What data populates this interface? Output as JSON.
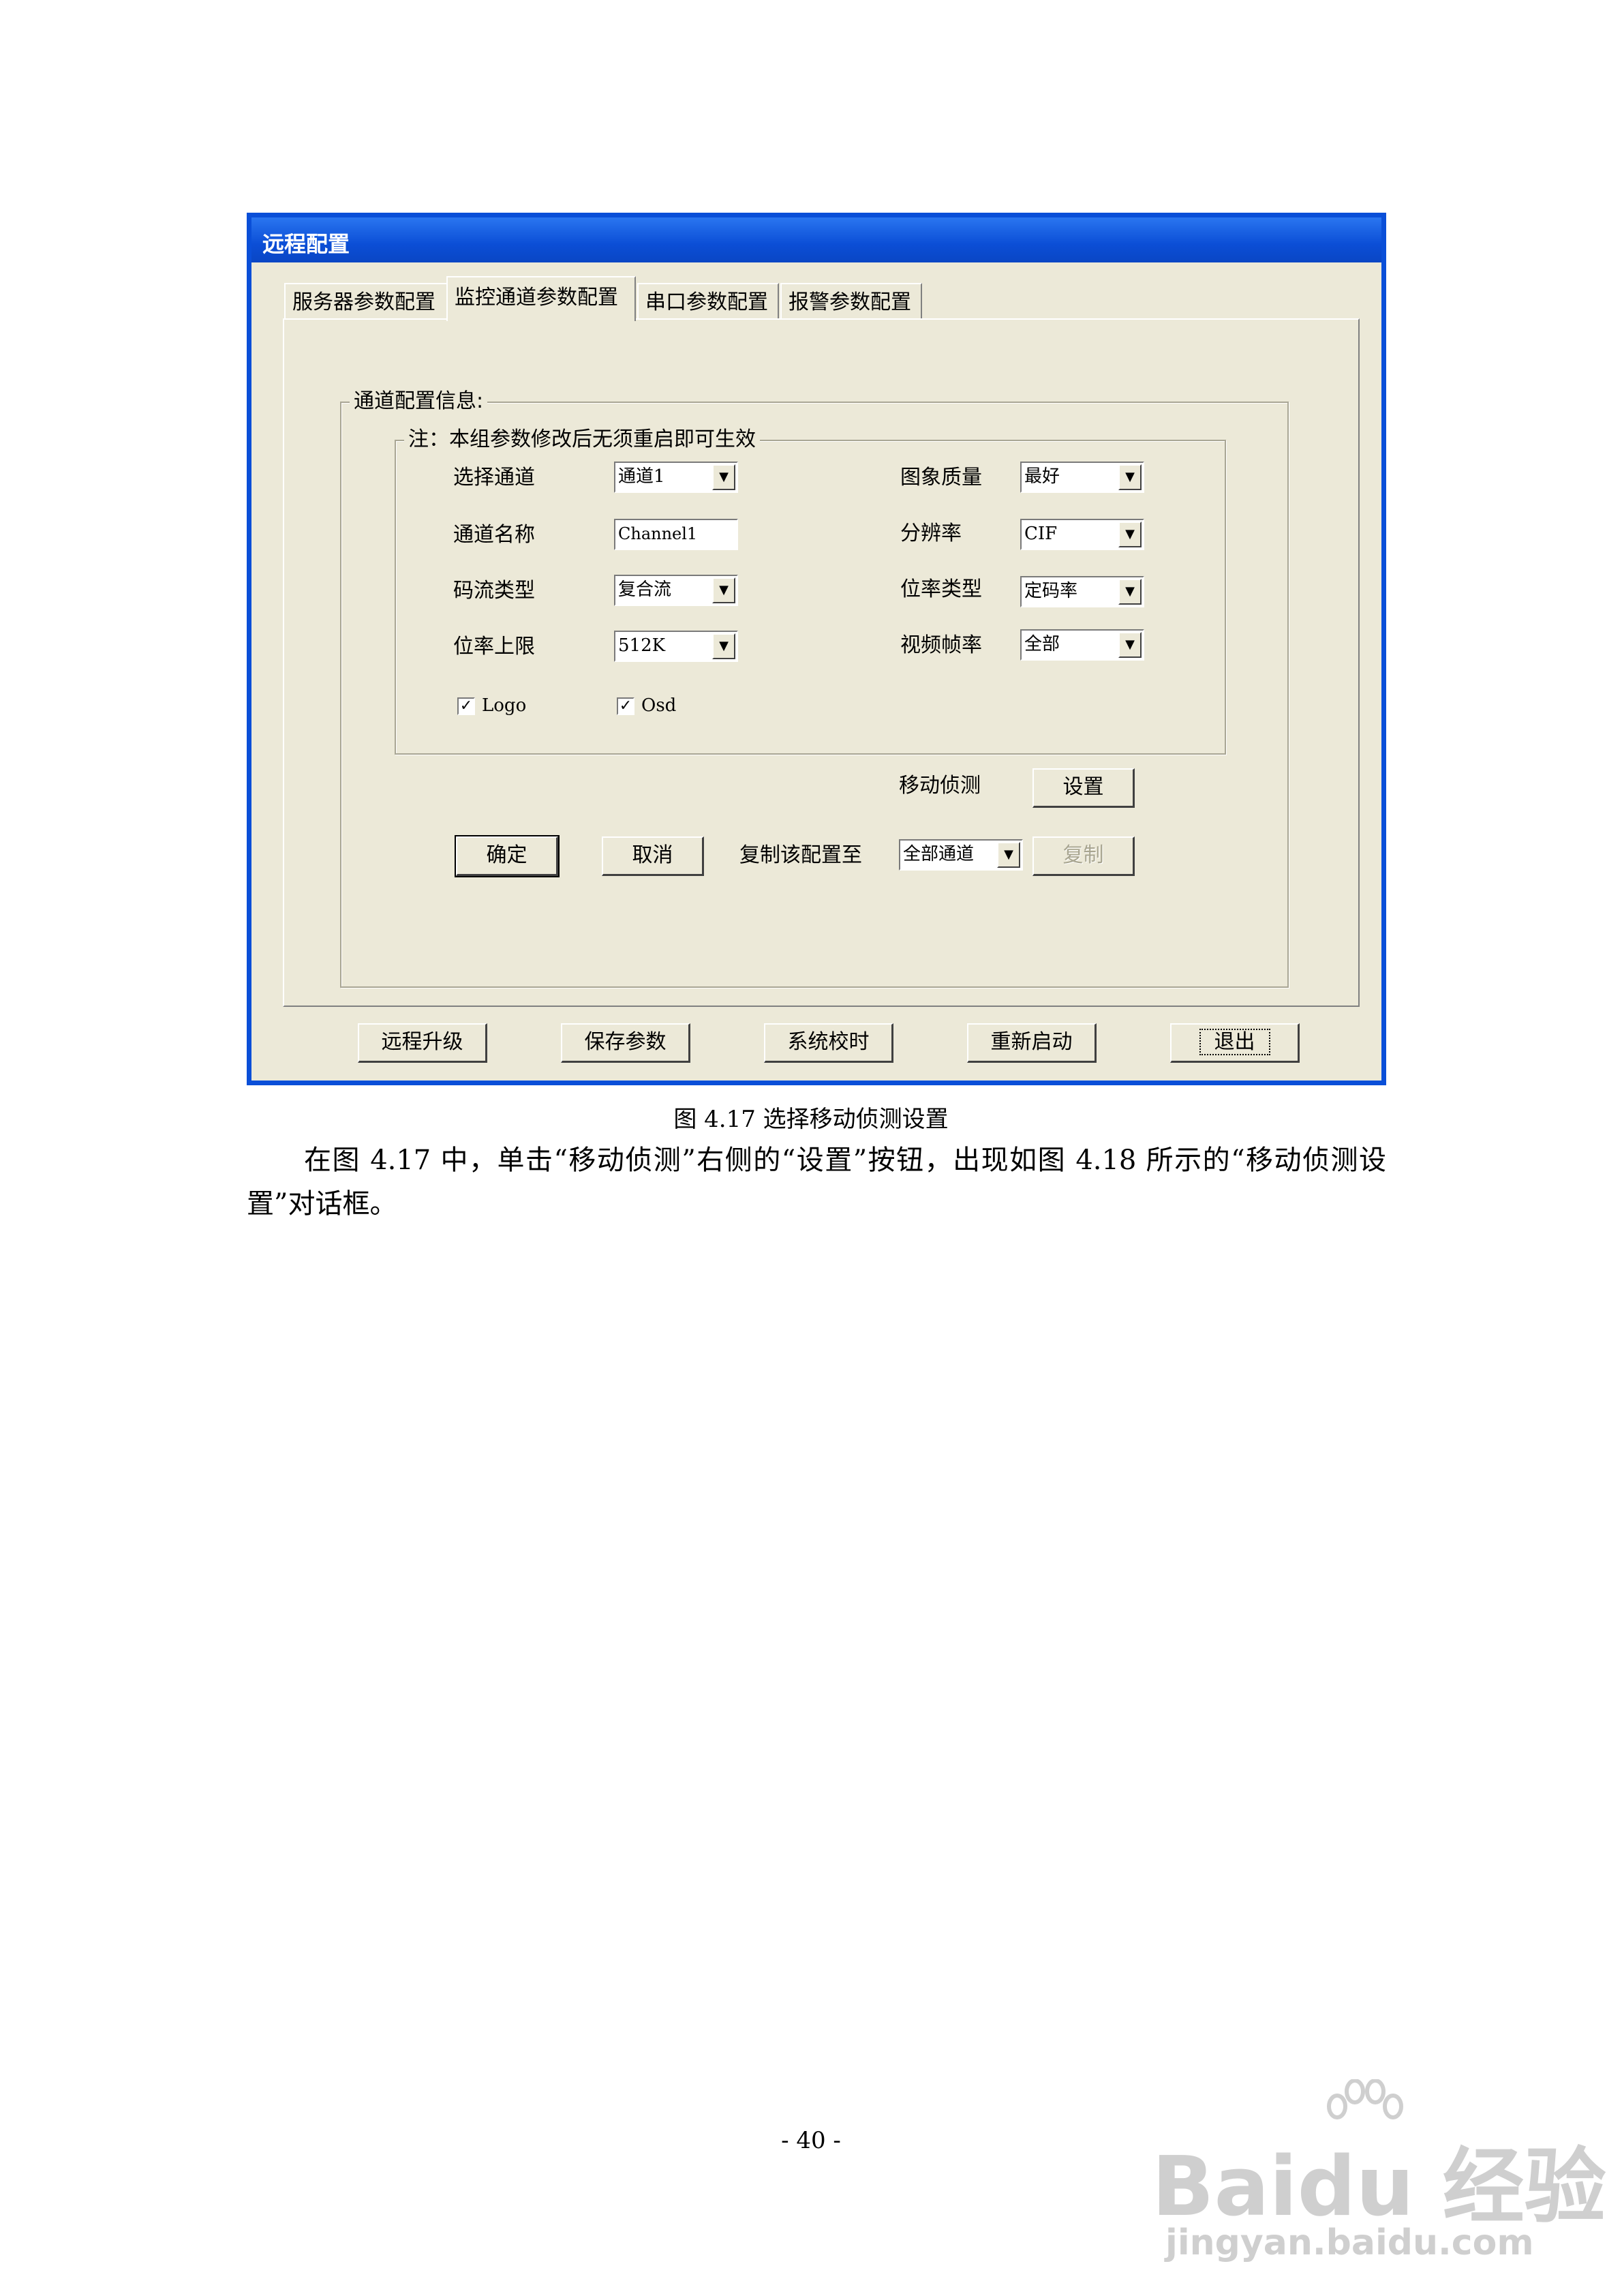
{
  "dialog": {
    "title": "远程配置",
    "tabs": [
      {
        "label": "服务器参数配置"
      },
      {
        "label": "监控通道参数配置"
      },
      {
        "label": "串口参数配置"
      },
      {
        "label": "报警参数配置"
      }
    ],
    "channel_group_label": "通道配置信息:",
    "note_group_label": "注：本组参数修改后无须重启即可生效",
    "fields": {
      "select_channel": {
        "label": "选择通道",
        "value": "通道1"
      },
      "channel_name": {
        "label": "通道名称",
        "value": "Channel1"
      },
      "stream_type": {
        "label": "码流类型",
        "value": "复合流"
      },
      "bitrate_limit": {
        "label": "位率上限",
        "value": "512K"
      },
      "image_quality": {
        "label": "图象质量",
        "value": "最好"
      },
      "resolution": {
        "label": "分辨率",
        "value": "CIF"
      },
      "bitrate_type": {
        "label": "位率类型",
        "value": "定码率"
      },
      "frame_rate": {
        "label": "视频帧率",
        "value": "全部"
      }
    },
    "checkboxes": {
      "logo": {
        "label": "Logo",
        "checked": true
      },
      "osd": {
        "label": "Osd",
        "checked": true
      }
    },
    "motion_detect": {
      "label": "移动侦测",
      "button": "设置"
    },
    "ok_button": "确定",
    "cancel_button": "取消",
    "copy_to": {
      "label": "复制该配置至",
      "value": "全部通道",
      "button": "复制"
    },
    "bottom_buttons": {
      "remote_upgrade": "远程升级",
      "save_params": "保存参数",
      "time_sync": "系统校时",
      "restart": "重新启动",
      "exit": "退出"
    }
  },
  "caption": "图 4.17  选择移动侦测设置",
  "paragraph": "在图 4.17 中，单击“移动侦测”右侧的“设置”按钮，出现如图 4.18 所示的“移动侦测设置”对话框。",
  "page_number": "- 40 -",
  "watermark": {
    "brand": "Baidu 经验",
    "url": "jingyan.baidu.com"
  }
}
